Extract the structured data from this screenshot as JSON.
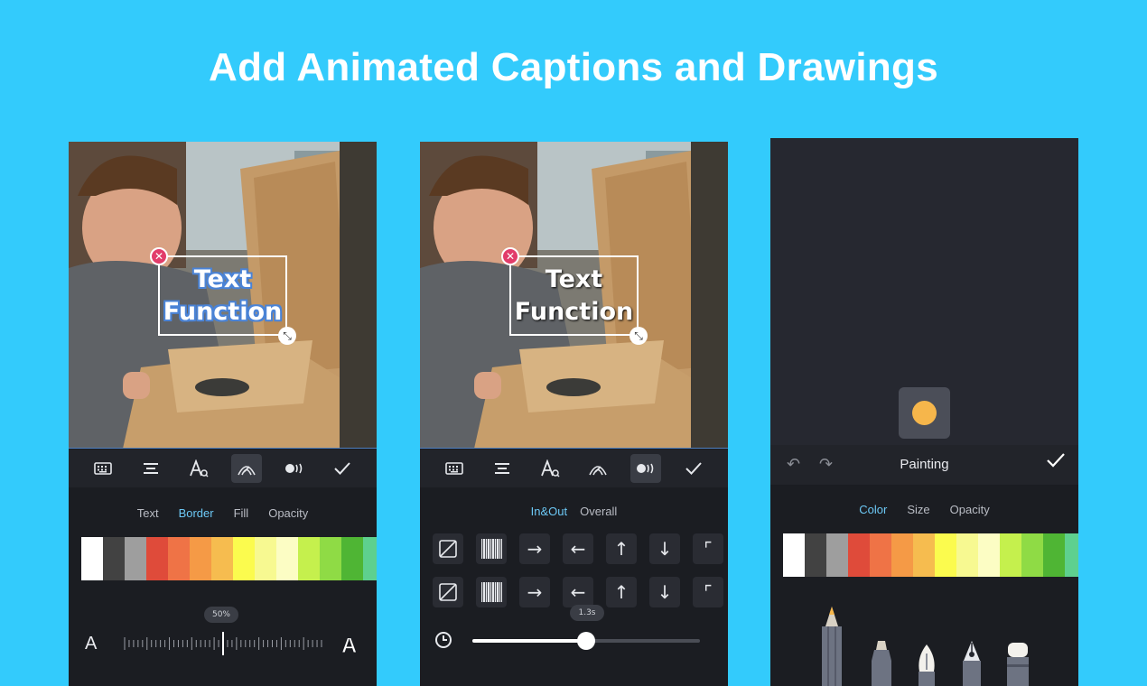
{
  "headline": "Add Animated Captions and Drawings",
  "colors": {
    "background": "#33cbfc",
    "accent": "#6cc8f5",
    "panel": "#1b1d22"
  },
  "palette": [
    "#ffffff",
    "#424242",
    "#9e9e9e",
    "#df4b3a",
    "#ef7346",
    "#f59a46",
    "#f6bc4f",
    "#fbfb4e",
    "#f7f991",
    "#fcfdc4",
    "#c5f04d",
    "#8fdb45",
    "#4fb534",
    "#5ed08f"
  ],
  "screen1": {
    "caption": "Text\nFunction",
    "toolbar_icons": [
      "keyboard-icon",
      "align-icon",
      "font-icon",
      "border-style-icon",
      "animation-icon",
      "confirm-check-icon"
    ],
    "tabs": [
      "Text",
      "Border",
      "Fill",
      "Opacity"
    ],
    "active_tab": "Border",
    "slider_value_label": "50%",
    "slider_value": 0.5,
    "ruler_min_label": "A",
    "ruler_max_label": "A"
  },
  "screen2": {
    "caption": "Text\nFunction",
    "toolbar_icons": [
      "keyboard-icon",
      "align-icon",
      "font-icon",
      "border-style-icon",
      "animation-icon",
      "confirm-check-icon"
    ],
    "tabs": [
      "In&Out",
      "Overall"
    ],
    "active_tab": "In&Out",
    "animation_rows": [
      [
        "none-icon",
        "barcode-icon",
        "arrow-right-icon",
        "arrow-left-icon",
        "arrow-up-icon",
        "arrow-down-icon",
        "expand-icon"
      ],
      [
        "none-icon",
        "barcode-icon",
        "arrow-right-icon",
        "arrow-left-icon",
        "arrow-up-icon",
        "arrow-down-icon",
        "expand-icon"
      ]
    ],
    "duration_label": "1.3s",
    "duration_fraction": 0.5
  },
  "screen3": {
    "title": "Painting",
    "brush_color": "#f6b64b",
    "tabs": [
      "Color",
      "Size",
      "Opacity"
    ],
    "active_tab": "Color",
    "tools": [
      "pencil-icon",
      "marker-icon",
      "fountain-pen-icon",
      "calligraphy-pen-icon",
      "eraser-icon"
    ]
  }
}
